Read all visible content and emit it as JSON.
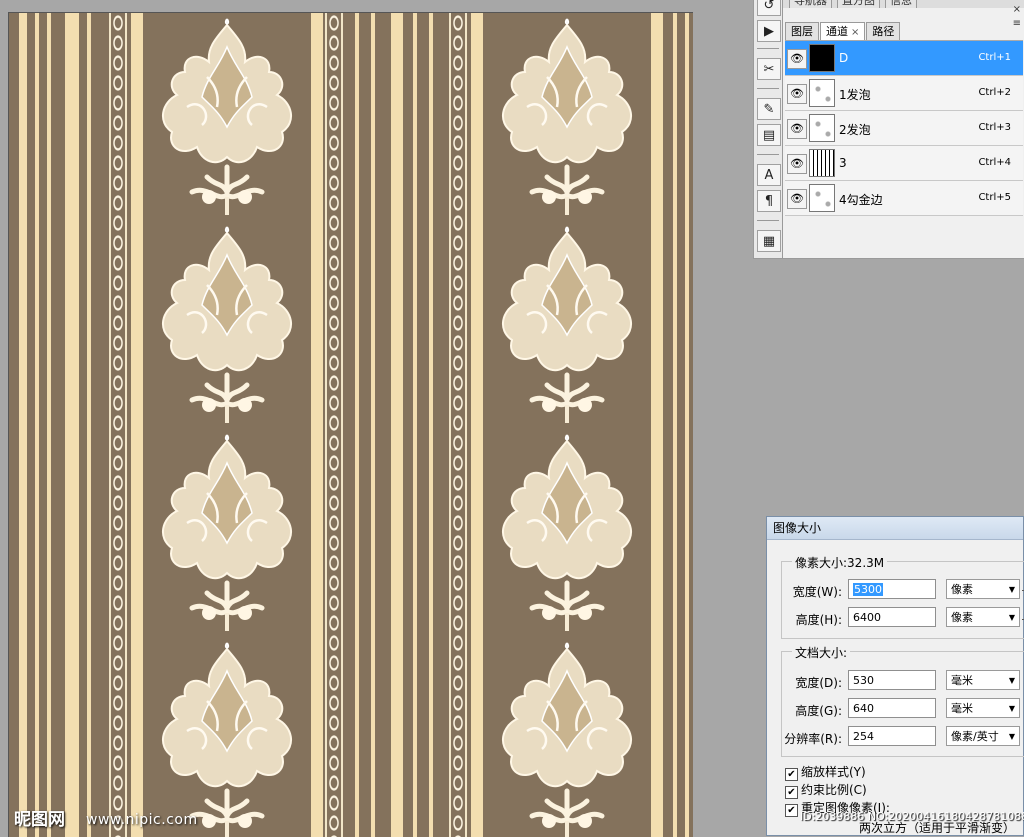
{
  "watermark": {
    "logo": "昵图网",
    "url": "www.nipic.com",
    "id_text": "ID:2039886 NO:20200416180428781088"
  },
  "panel": {
    "top_tabs": [
      "导航器",
      "直方图",
      "信息"
    ],
    "tabs": [
      {
        "label": "图层",
        "active": false
      },
      {
        "label": "通道",
        "active": true,
        "closable": true
      },
      {
        "label": "路径",
        "active": false
      }
    ],
    "close_glyph": "×",
    "menu_glyph": "≡",
    "channels": [
      {
        "name": "D",
        "shortcut": "Ctrl+1",
        "thumb": "black",
        "selected": true
      },
      {
        "name": "1发泡",
        "shortcut": "Ctrl+2",
        "thumb": "pattern",
        "selected": false
      },
      {
        "name": "2发泡",
        "shortcut": "Ctrl+3",
        "thumb": "pattern",
        "selected": false
      },
      {
        "name": "3",
        "shortcut": "Ctrl+4",
        "thumb": "stripes",
        "selected": false
      },
      {
        "name": "4勾金边",
        "shortcut": "Ctrl+5",
        "thumb": "pattern",
        "selected": false
      }
    ]
  },
  "toolstrip": {
    "tools": [
      "history-icon",
      "actions-icon",
      "tool-presets-icon",
      "brushes-icon",
      "clone-source-icon",
      "character-icon",
      "paragraph-icon",
      "layer-comps-icon"
    ]
  },
  "dialog": {
    "title": "图像大小",
    "pixel_group_title": "像素大小:32.3M",
    "pixel_width_label": "宽度(W):",
    "pixel_width_value": "5300",
    "pixel_width_unit": "像素",
    "pixel_height_label": "高度(H):",
    "pixel_height_value": "6400",
    "pixel_height_unit": "像素",
    "doc_group_title": "文档大小:",
    "doc_width_label": "宽度(D):",
    "doc_width_value": "530",
    "doc_width_unit": "毫米",
    "doc_height_label": "高度(G):",
    "doc_height_value": "640",
    "doc_height_unit": "毫米",
    "resolution_label": "分辨率(R):",
    "resolution_value": "254",
    "resolution_unit": "像素/英寸",
    "scale_styles": "缩放样式(Y)",
    "constrain": "约束比例(C)",
    "resample": "重定图像像素(I):",
    "resample_method": "两次立方（适用于平滑渐变）"
  }
}
